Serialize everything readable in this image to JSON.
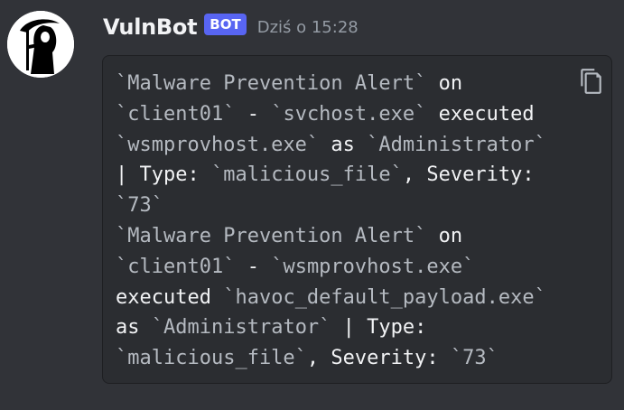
{
  "message": {
    "author": "VulnBot",
    "badge": "BOT",
    "timestamp": "Dziś o 15:28"
  },
  "code_lines": [
    [
      {
        "t": "`Malware Prevention Alert`",
        "c": "tick"
      },
      {
        "t": " on",
        "c": "plain"
      }
    ],
    [
      {
        "t": "`client01`",
        "c": "tick"
      },
      {
        "t": " - ",
        "c": "plain"
      },
      {
        "t": "`svchost.exe`",
        "c": "tick"
      },
      {
        "t": " executed",
        "c": "plain"
      }
    ],
    [
      {
        "t": "`wsmprovhost.exe`",
        "c": "tick"
      },
      {
        "t": " as ",
        "c": "plain"
      },
      {
        "t": "`Administrator`",
        "c": "tick"
      }
    ],
    [
      {
        "t": "| Type: ",
        "c": "plain"
      },
      {
        "t": "`malicious_file`",
        "c": "tick"
      },
      {
        "t": ", Severity:",
        "c": "plain"
      }
    ],
    [
      {
        "t": "`73`",
        "c": "tick"
      }
    ],
    [
      {
        "t": "`Malware Prevention Alert`",
        "c": "tick"
      },
      {
        "t": " on",
        "c": "plain"
      }
    ],
    [
      {
        "t": "`client01`",
        "c": "tick"
      },
      {
        "t": " - ",
        "c": "plain"
      },
      {
        "t": "`wsmprovhost.exe`",
        "c": "tick"
      }
    ],
    [
      {
        "t": "executed ",
        "c": "plain"
      },
      {
        "t": "`havoc_default_payload.exe`",
        "c": "tick"
      }
    ],
    [
      {
        "t": "as ",
        "c": "plain"
      },
      {
        "t": "`Administrator`",
        "c": "tick"
      },
      {
        "t": " | Type:",
        "c": "plain"
      }
    ],
    [
      {
        "t": "`malicious_file`",
        "c": "tick"
      },
      {
        "t": ", Severity: ",
        "c": "plain"
      },
      {
        "t": "`73`",
        "c": "tick"
      }
    ]
  ],
  "icons": {
    "avatar": "grim-reaper-avatar",
    "copy": "copy-icon"
  }
}
